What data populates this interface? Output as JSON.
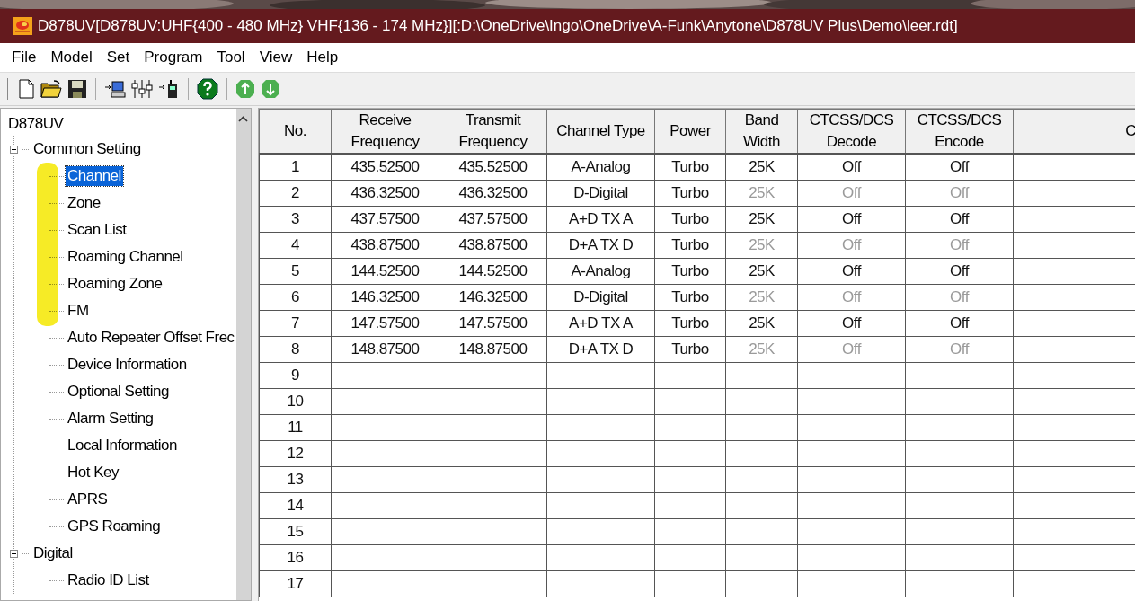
{
  "window": {
    "title": "D878UV[D878UV:UHF{400 - 480 MHz} VHF{136 - 174 MHz}][:D:\\OneDrive\\Ingo\\OneDrive\\A-Funk\\Anytone\\D878UV Plus\\Demo\\leer.rdt]"
  },
  "menu": [
    "File",
    "Model",
    "Set",
    "Program",
    "Tool",
    "View",
    "Help"
  ],
  "tree": {
    "label": "D878UV",
    "children": [
      {
        "label": "Common Setting",
        "expanded": true,
        "selected": false,
        "children": [
          {
            "label": "Channel",
            "selected": true
          },
          {
            "label": "Zone",
            "selected": false
          },
          {
            "label": "Scan List",
            "selected": false
          },
          {
            "label": "Roaming Channel",
            "selected": false
          },
          {
            "label": "Roaming Zone",
            "selected": false
          },
          {
            "label": "FM",
            "selected": false
          },
          {
            "label": "Auto Repeater Offset Frec",
            "selected": false
          },
          {
            "label": "Device Information",
            "selected": false
          },
          {
            "label": "Optional Setting",
            "selected": false
          },
          {
            "label": "Alarm Setting",
            "selected": false
          },
          {
            "label": "Local Information",
            "selected": false
          },
          {
            "label": "Hot Key",
            "selected": false
          },
          {
            "label": "APRS",
            "selected": false
          },
          {
            "label": "GPS Roaming",
            "selected": false
          }
        ]
      },
      {
        "label": "Digital",
        "expanded": true,
        "selected": false,
        "children": [
          {
            "label": "Radio ID List",
            "selected": false
          }
        ]
      }
    ]
  },
  "table": {
    "columns": [
      "No.",
      "Receive Frequency",
      "Transmit Frequency",
      "Channel Type",
      "Power",
      "Band Width",
      "CTCSS/DCS Decode",
      "CTCSS/DCS Encode",
      "C"
    ],
    "rows": [
      {
        "no": "1",
        "rx": "435.52500",
        "tx": "435.52500",
        "type": "A-Analog",
        "power": "Turbo",
        "bw": "25K",
        "decode": "Off",
        "encode": "Off",
        "disabled": false
      },
      {
        "no": "2",
        "rx": "436.32500",
        "tx": "436.32500",
        "type": "D-Digital",
        "power": "Turbo",
        "bw": "25K",
        "decode": "Off",
        "encode": "Off",
        "disabled": true
      },
      {
        "no": "3",
        "rx": "437.57500",
        "tx": "437.57500",
        "type": "A+D TX A",
        "power": "Turbo",
        "bw": "25K",
        "decode": "Off",
        "encode": "Off",
        "disabled": false
      },
      {
        "no": "4",
        "rx": "438.87500",
        "tx": "438.87500",
        "type": "D+A TX D",
        "power": "Turbo",
        "bw": "25K",
        "decode": "Off",
        "encode": "Off",
        "disabled": true
      },
      {
        "no": "5",
        "rx": "144.52500",
        "tx": "144.52500",
        "type": "A-Analog",
        "power": "Turbo",
        "bw": "25K",
        "decode": "Off",
        "encode": "Off",
        "disabled": false
      },
      {
        "no": "6",
        "rx": "146.32500",
        "tx": "146.32500",
        "type": "D-Digital",
        "power": "Turbo",
        "bw": "25K",
        "decode": "Off",
        "encode": "Off",
        "disabled": true
      },
      {
        "no": "7",
        "rx": "147.57500",
        "tx": "147.57500",
        "type": "A+D TX A",
        "power": "Turbo",
        "bw": "25K",
        "decode": "Off",
        "encode": "Off",
        "disabled": false
      },
      {
        "no": "8",
        "rx": "148.87500",
        "tx": "148.87500",
        "type": "D+A TX D",
        "power": "Turbo",
        "bw": "25K",
        "decode": "Off",
        "encode": "Off",
        "disabled": true
      },
      {
        "no": "9"
      },
      {
        "no": "10"
      },
      {
        "no": "11"
      },
      {
        "no": "12"
      },
      {
        "no": "13"
      },
      {
        "no": "14"
      },
      {
        "no": "15"
      },
      {
        "no": "16"
      },
      {
        "no": "17"
      }
    ]
  }
}
